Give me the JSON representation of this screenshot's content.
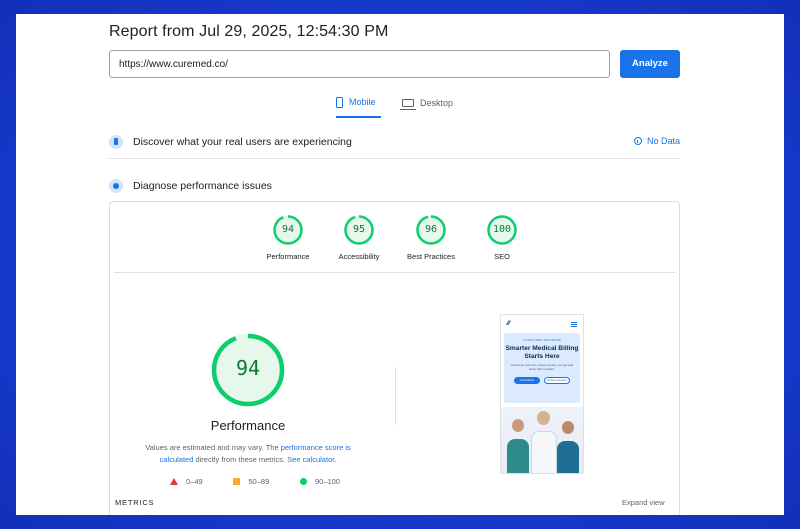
{
  "report": {
    "title": "Report from Jul 29, 2025, 12:54:30 PM"
  },
  "url_input": {
    "value": "https://www.curemed.co/"
  },
  "analyze_button": {
    "label": "Analyze"
  },
  "tabs": [
    {
      "label": "Mobile",
      "icon": "phone-icon",
      "active": true
    },
    {
      "label": "Desktop",
      "icon": "laptop-icon",
      "active": false
    }
  ],
  "sections": {
    "real_users": {
      "title": "Discover what your real users are experiencing",
      "status": "No Data"
    },
    "diagnose": {
      "title": "Diagnose performance issues"
    }
  },
  "scores": [
    {
      "label": "Performance",
      "value": "94",
      "fraction": 0.94
    },
    {
      "label": "Accessibility",
      "value": "95",
      "fraction": 0.95
    },
    {
      "label": "Best Practices",
      "value": "96",
      "fraction": 0.96
    },
    {
      "label": "SEO",
      "value": "100",
      "fraction": 1.0
    }
  ],
  "main_score": {
    "value": "94",
    "fraction": 0.94,
    "label": "Performance"
  },
  "note": {
    "part1": "Values are estimated and may vary. The ",
    "link1": "performance score is calculated",
    "part2": " directly from these metrics. ",
    "link2": "See calculator",
    "part3": "."
  },
  "legend": [
    {
      "range": "0–49",
      "shape": "triangle",
      "color": "#e53935"
    },
    {
      "range": "50–89",
      "shape": "square",
      "color": "#ffa726"
    },
    {
      "range": "90–100",
      "shape": "circle",
      "color": "#0cce6b"
    }
  ],
  "metrics": {
    "label": "METRICS",
    "expand": "Expand view"
  },
  "preview": {
    "kicker": "CLINIC-FIRST SOLUTIONS",
    "headline": "Smarter Medical Billing Starts Here",
    "subtext": "Accelerate cash flow, reduce denials, and get paid faster with CureMed.",
    "button_primary": "Get Started",
    "button_secondary": "Explore Services"
  },
  "colors": {
    "accent": "#1a73e8",
    "pass": "#0cce6b",
    "pass_text": "#0c7a2e"
  }
}
